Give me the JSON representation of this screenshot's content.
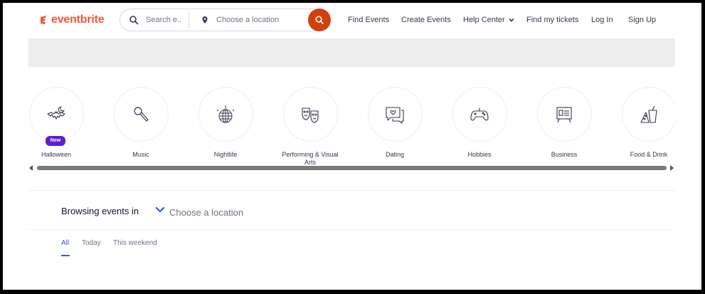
{
  "brand": {
    "name": "eventbrite",
    "color": "#f05537"
  },
  "search": {
    "query_placeholder": "Search e...",
    "location_placeholder": "Choose a location",
    "button_color": "#d1410c"
  },
  "nav": {
    "find_events": "Find Events",
    "create_events": "Create Events",
    "help_center": "Help Center",
    "find_my_tickets": "Find my tickets",
    "log_in": "Log In",
    "sign_up": "Sign Up"
  },
  "categories": [
    {
      "label": "Halloween",
      "icon": "bat-moon-icon",
      "badge": "New"
    },
    {
      "label": "Music",
      "icon": "microphone-icon"
    },
    {
      "label": "Nightlife",
      "icon": "disco-ball-icon"
    },
    {
      "label": "Performing & Visual Arts",
      "icon": "theater-masks-icon"
    },
    {
      "label": "Dating",
      "icon": "chat-heart-icon"
    },
    {
      "label": "Hobbies",
      "icon": "gamepad-icon"
    },
    {
      "label": "Business",
      "icon": "presentation-board-icon"
    },
    {
      "label": "Food & Drink",
      "icon": "food-drink-icon"
    }
  ],
  "browse": {
    "label": "Browsing events in",
    "location": "Choose a location"
  },
  "tabs": [
    {
      "label": "All",
      "active": true
    },
    {
      "label": "Today",
      "active": false
    },
    {
      "label": "This weekend",
      "active": false
    }
  ],
  "colors": {
    "accent": "#3659e3",
    "badge": "#5c1fd1",
    "text": "#39364f"
  }
}
